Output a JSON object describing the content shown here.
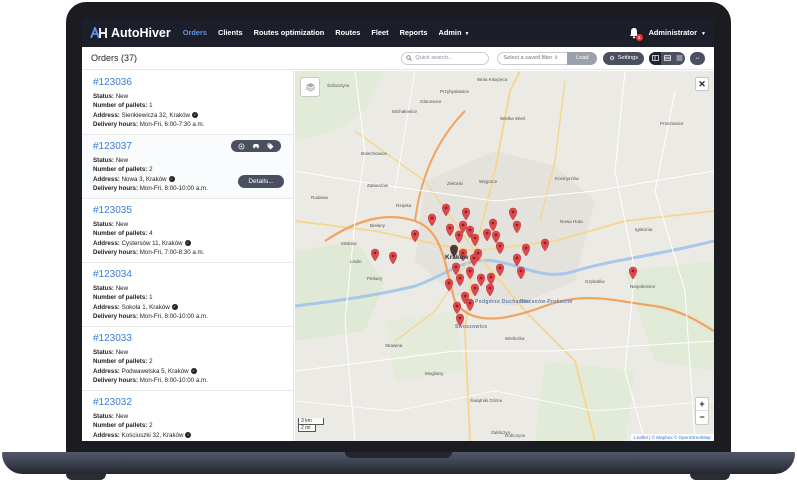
{
  "nav": {
    "brand": "AutoHiver",
    "items": [
      "Orders",
      "Clients",
      "Routes optimization",
      "Routes",
      "Fleet",
      "Reports",
      "Admin"
    ],
    "active": "Orders",
    "notification_count": "1",
    "user": "Administrator"
  },
  "toolbar": {
    "title": "Orders (37)",
    "search_placeholder": "Quick search...",
    "filter_placeholder": "Select a saved filter",
    "load_label": "Load",
    "settings_label": "Settings"
  },
  "labels": {
    "status": "Status:",
    "pallets": "Number of pallets:",
    "address": "Address:",
    "hours": "Delivery hours:",
    "details": "Details..."
  },
  "orders": [
    {
      "id": "#123036",
      "status": "New",
      "pallets": "1",
      "address": "Sienkiewicza 32, Kraków",
      "hours": "Mon-Fri, 6:00-7:30 a.m."
    },
    {
      "id": "#123037",
      "status": "New",
      "pallets": "2",
      "address": "Nowa 3, Kraków",
      "hours": "Mon-Fri, 8:00-10:00 a.m."
    },
    {
      "id": "#123035",
      "status": "New",
      "pallets": "4",
      "address": "Cystersów 11, Kraków",
      "hours": "Mon-Fri, 7:00-8:30 a.m."
    },
    {
      "id": "#123034",
      "status": "New",
      "pallets": "1",
      "address": "Sokola 1, Kraków",
      "hours": "Mon-Fri, 8:00-10:00 a.m."
    },
    {
      "id": "#123033",
      "status": "New",
      "pallets": "2",
      "address": "Podwawelska 5, Kraków",
      "hours": "Mon-Fri, 8:00-10:00 a.m."
    },
    {
      "id": "#123032",
      "status": "New",
      "pallets": "2",
      "address": "Kościuszki 32, Kraków",
      "hours": ""
    }
  ],
  "map": {
    "places": [
      {
        "name": "Przybysławice"
      },
      {
        "name": "Wola Książęca"
      },
      {
        "name": "Ściborzyce"
      },
      {
        "name": "Michałowice"
      },
      {
        "name": "Glanowice"
      },
      {
        "name": "Wielka Wieś"
      },
      {
        "name": "Zielonki"
      },
      {
        "name": "Węgrzce"
      },
      {
        "name": "Bolechowice"
      },
      {
        "name": "Zabierzów"
      },
      {
        "name": "Rząska"
      },
      {
        "name": "Bielany"
      },
      {
        "name": "Rudawa"
      },
      {
        "name": "Mników"
      },
      {
        "name": "Liszki"
      },
      {
        "name": "Piekary"
      },
      {
        "name": "Kraków"
      },
      {
        "name": "Nowa Huta"
      },
      {
        "name": "Wieliczka"
      },
      {
        "name": "Skawina"
      },
      {
        "name": "Niepołomice"
      },
      {
        "name": "Mogilany"
      },
      {
        "name": "Świątniki Górne"
      },
      {
        "name": "Dobczyce"
      },
      {
        "name": "Kocmyrzów"
      },
      {
        "name": "Igołomia"
      },
      {
        "name": "Proszowice"
      },
      {
        "name": "Zakliczyn"
      },
      {
        "name": "Podgórze Duchackie"
      },
      {
        "name": "Bieżanów-Prokocim"
      },
      {
        "name": "Swoszowice"
      },
      {
        "name": "Grębałów"
      }
    ],
    "scale_km": "3 km",
    "scale_mi": "2 mi",
    "attribution": "Leaflet | © Mapbox © OpenStreetMap"
  }
}
